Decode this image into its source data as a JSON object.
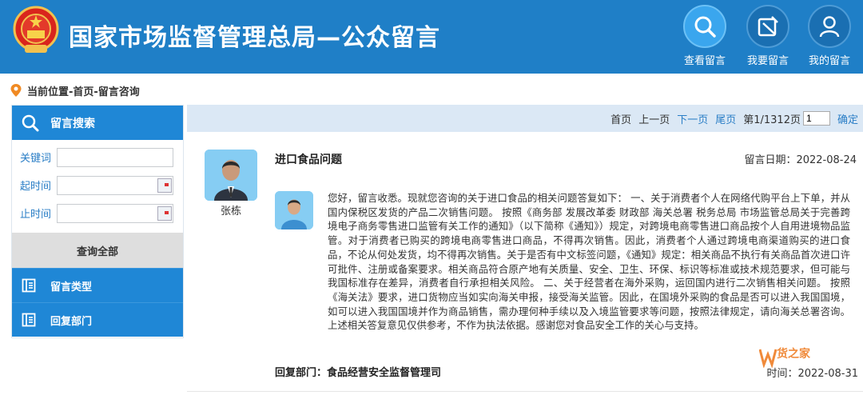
{
  "header": {
    "site_title": "国家市场监督管理总局—公众留言",
    "nav": [
      {
        "label": "查看留言",
        "icon": "search-icon"
      },
      {
        "label": "我要留言",
        "icon": "edit-icon"
      },
      {
        "label": "我的留言",
        "icon": "user-icon"
      }
    ],
    "brand_color": "#1f7fc7"
  },
  "breadcrumb": "当前位置-首页-留言咨询",
  "sidebar": {
    "search_title": "留言搜索",
    "keyword_label": "关键词",
    "keyword_value": "",
    "start_label": "起时间",
    "start_value": "",
    "end_label": "止时间",
    "end_value": "",
    "query_all": "查询全部",
    "categories": [
      {
        "label": "留言类型",
        "icon": "list-icon"
      },
      {
        "label": "回复部门",
        "icon": "list-icon"
      }
    ]
  },
  "pager": {
    "first": "首页",
    "prev": "上一页",
    "next": "下一页",
    "last": "尾页",
    "page_info": "第1/1312页",
    "page_input": "1",
    "confirm": "确定"
  },
  "message": {
    "asker_name": "张栋",
    "title": "进口食品问题",
    "date": "留言日期：2022-08-24",
    "reply": "您好，留言收悉。现就您咨询的关于进口食品的相关问题答复如下： 一、关于消费者个人在网络代购平台上下单，并从国内保税区发货的产品二次销售问题。 按照《商务部 发展改革委 财政部 海关总署 税务总局 市场监管总局关于完善跨境电子商务零售进口监管有关工作的通知》（以下简称《通知》）规定，对跨境电商零售进口商品按个人自用进境物品监管。对于消费者已购买的跨境电商零售进口商品，不得再次销售。因此，消费者个人通过跨境电商渠道购买的进口食品，不论从何处发货，均不得再次销售。关于是否有中文标签问题，《通知》规定：相关商品不执行有关商品首次进口许可批件、注册或备案要求。相关商品符合原产地有关质量、安全、卫生、环保、标识等标准或技术规范要求，但可能与我国标准存在差异，消费者自行承担相关风险。 二、关于经营者在海外采购，运回国内进行二次销售相关问题。 按照《海关法》要求，进口货物应当如实向海关申报，接受海关监管。因此，在国境外采购的食品是否可以进入我国国境，如可以进入我国国境并作为商品销售，需办理何种手续以及入境监管要求等问题，按照法律规定，请向海关总署咨询。 上述相关答复意见仅供参考，不作为执法依据。感谢您对食品安全工作的关心与支持。",
    "dept_label": "回复部门：",
    "dept_name": "食品经营安全监督管理司",
    "reply_time": "时间：2022-08-31"
  },
  "watermark": {
    "text": "货之家"
  }
}
